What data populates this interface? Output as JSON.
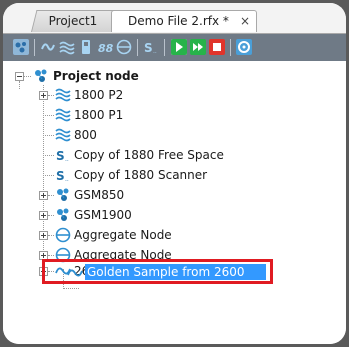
{
  "tabs": [
    {
      "label": "Project1",
      "active": false
    },
    {
      "label": "Demo File 2.rfx *",
      "active": true,
      "close": "×"
    }
  ],
  "toolbar": {
    "buttons": [
      "project-node-icon",
      "waveform-icon",
      "multi-wave-icon",
      "device-icon",
      "grid-icon",
      "aggregate-icon",
      "scanner-icon",
      "play-icon",
      "fast-forward-icon",
      "stop-icon",
      "settings-icon"
    ],
    "colors": {
      "background": "#6f7a86",
      "play": "#27b34a",
      "stop": "#e0342b",
      "icon": "#a8d4f2"
    }
  },
  "tree": {
    "root": {
      "label": "Project node",
      "icon": "project-node-icon",
      "expanded": true
    },
    "items": [
      {
        "label": "1800 P2",
        "icon": "multi-wave-icon",
        "expander": "plus"
      },
      {
        "label": "1800 P1",
        "icon": "multi-wave-icon",
        "expander": null
      },
      {
        "label": "800",
        "icon": "multi-wave-icon",
        "expander": null
      },
      {
        "label": "Copy of 1880 Free Space",
        "icon": "scanner-icon",
        "expander": null
      },
      {
        "label": "Copy of 1880 Scanner",
        "icon": "scanner-icon",
        "expander": null
      },
      {
        "label": "GSM850",
        "icon": "project-node-icon",
        "expander": "plus"
      },
      {
        "label": "GSM1900",
        "icon": "project-node-icon",
        "expander": "plus"
      },
      {
        "label": "Aggregate Node",
        "icon": "aggregate-icon",
        "expander": "plus"
      },
      {
        "label": "Aggregate Node",
        "icon": "aggregate-icon",
        "expander": "plus"
      },
      {
        "label": "2600",
        "icon": "waveform-icon",
        "expander": "minus"
      }
    ],
    "selected": {
      "label": "Golden Sample from 2600",
      "icon": "waveform-icon",
      "highlight": "#e01b22"
    }
  }
}
